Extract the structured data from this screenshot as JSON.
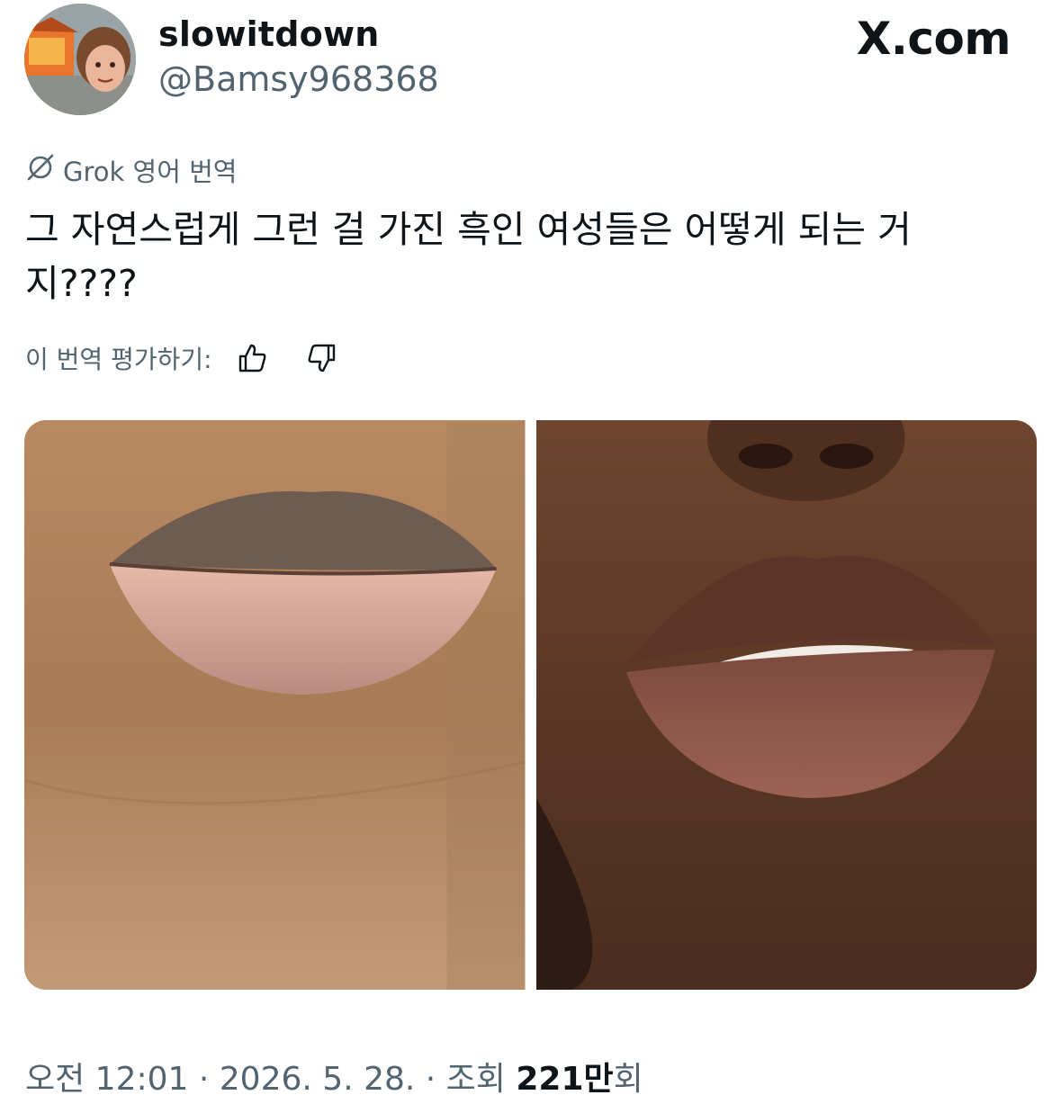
{
  "author": {
    "display_name": "slowitdown",
    "handle": "@Bamsy968368",
    "avatar_icon": "avatar-photo"
  },
  "brand": {
    "watermark": "X.com"
  },
  "translation": {
    "label": "Grok 영어 번역",
    "icon": "grok-icon"
  },
  "tweet": {
    "text": "그 자연스럽게 그런 걸 가진 흑인 여성들은 어떻게 되는 거\n지????"
  },
  "rating": {
    "label": "이 번역 평가하기:",
    "thumbs_up_icon": "thumbs-up-icon",
    "thumbs_down_icon": "thumbs-down-icon"
  },
  "media": {
    "images": [
      {
        "name": "lips-photo-left"
      },
      {
        "name": "lips-photo-right"
      }
    ]
  },
  "meta": {
    "time": "오전 12:01",
    "sep1": " · ",
    "date": "2026. 5. 28.",
    "sep2": " · ",
    "views_label": "조회 ",
    "views_count": "221만",
    "views_suffix": "회"
  },
  "colors": {
    "text": "#0f1419",
    "secondary": "#536471"
  }
}
